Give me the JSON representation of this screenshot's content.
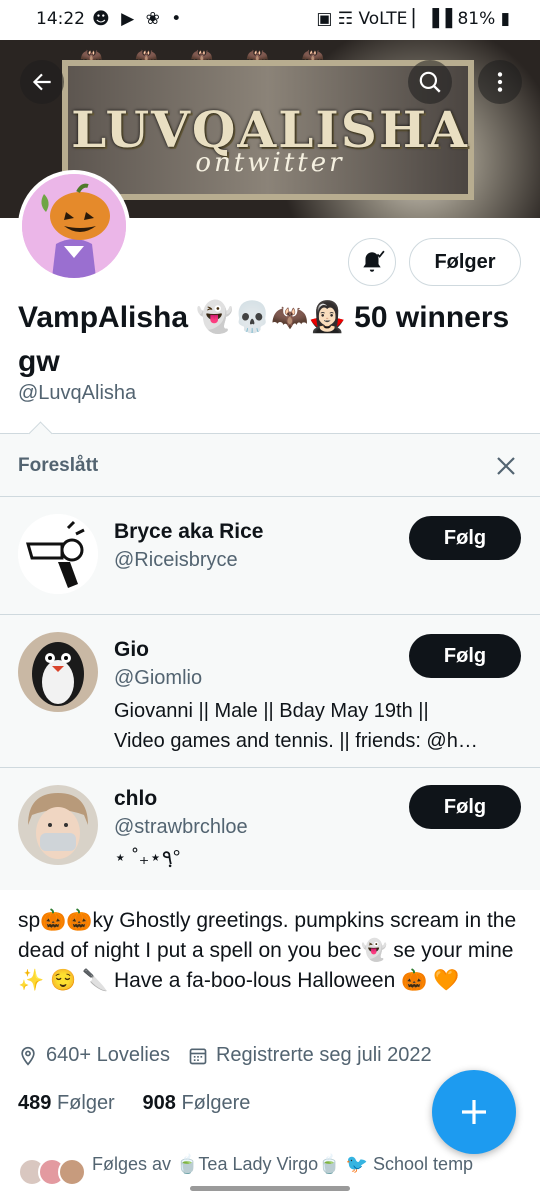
{
  "status_bar": {
    "time": "14:22",
    "left_icons": "☻ ▶ ❀ •",
    "right": "▣ ☶ VoLTE ▏▐▐ 81% ▮"
  },
  "banner": {
    "logo_text": "LUVQALISHA",
    "logo_sub": "ontwitter"
  },
  "profile": {
    "display_name": "VampAlisha 👻💀🦇🧛🏻‍♀️ 50 winners gw",
    "handle": "@LuvqAlisha",
    "following_button": "Følger",
    "bio": "sp🎃🎃ky   Ghostly greetings. pumpkins scream in the dead of night I put a spell on you bec👻 se your mine ✨ 😌 🔪  Have a fa-boo-lous Halloween 🎃 🧡",
    "location": "640+ Lovelies",
    "joined": "Registrerte seg juli 2022",
    "following_count": "489",
    "following_label": "Følger",
    "followers_count": "908",
    "followers_label": "Følgere",
    "followed_by": "Følges av 🍵Tea Lady Virgo🍵 🐦 School temp"
  },
  "suggestions": {
    "title": "Foreslått",
    "follow_label": "Følg",
    "items": [
      {
        "name": "Bryce aka Rice",
        "handle": "@Riceisbryce",
        "bio": ""
      },
      {
        "name": "Gio",
        "handle": "@Giomlio",
        "bio": "Giovanni || Male || Bday May 19th ||",
        "bio2": "Video games and tennis. || friends: @h…"
      },
      {
        "name": "chlo",
        "handle": "@strawbrchloe",
        "bio": "⋆ ˚₊⋆٩ฺ°"
      }
    ]
  },
  "colors": {
    "accent": "#1d9bf0",
    "text_primary": "#0f1419",
    "text_secondary": "#536471",
    "panel_bg": "#f7f9f9",
    "border": "#cfd9de"
  }
}
